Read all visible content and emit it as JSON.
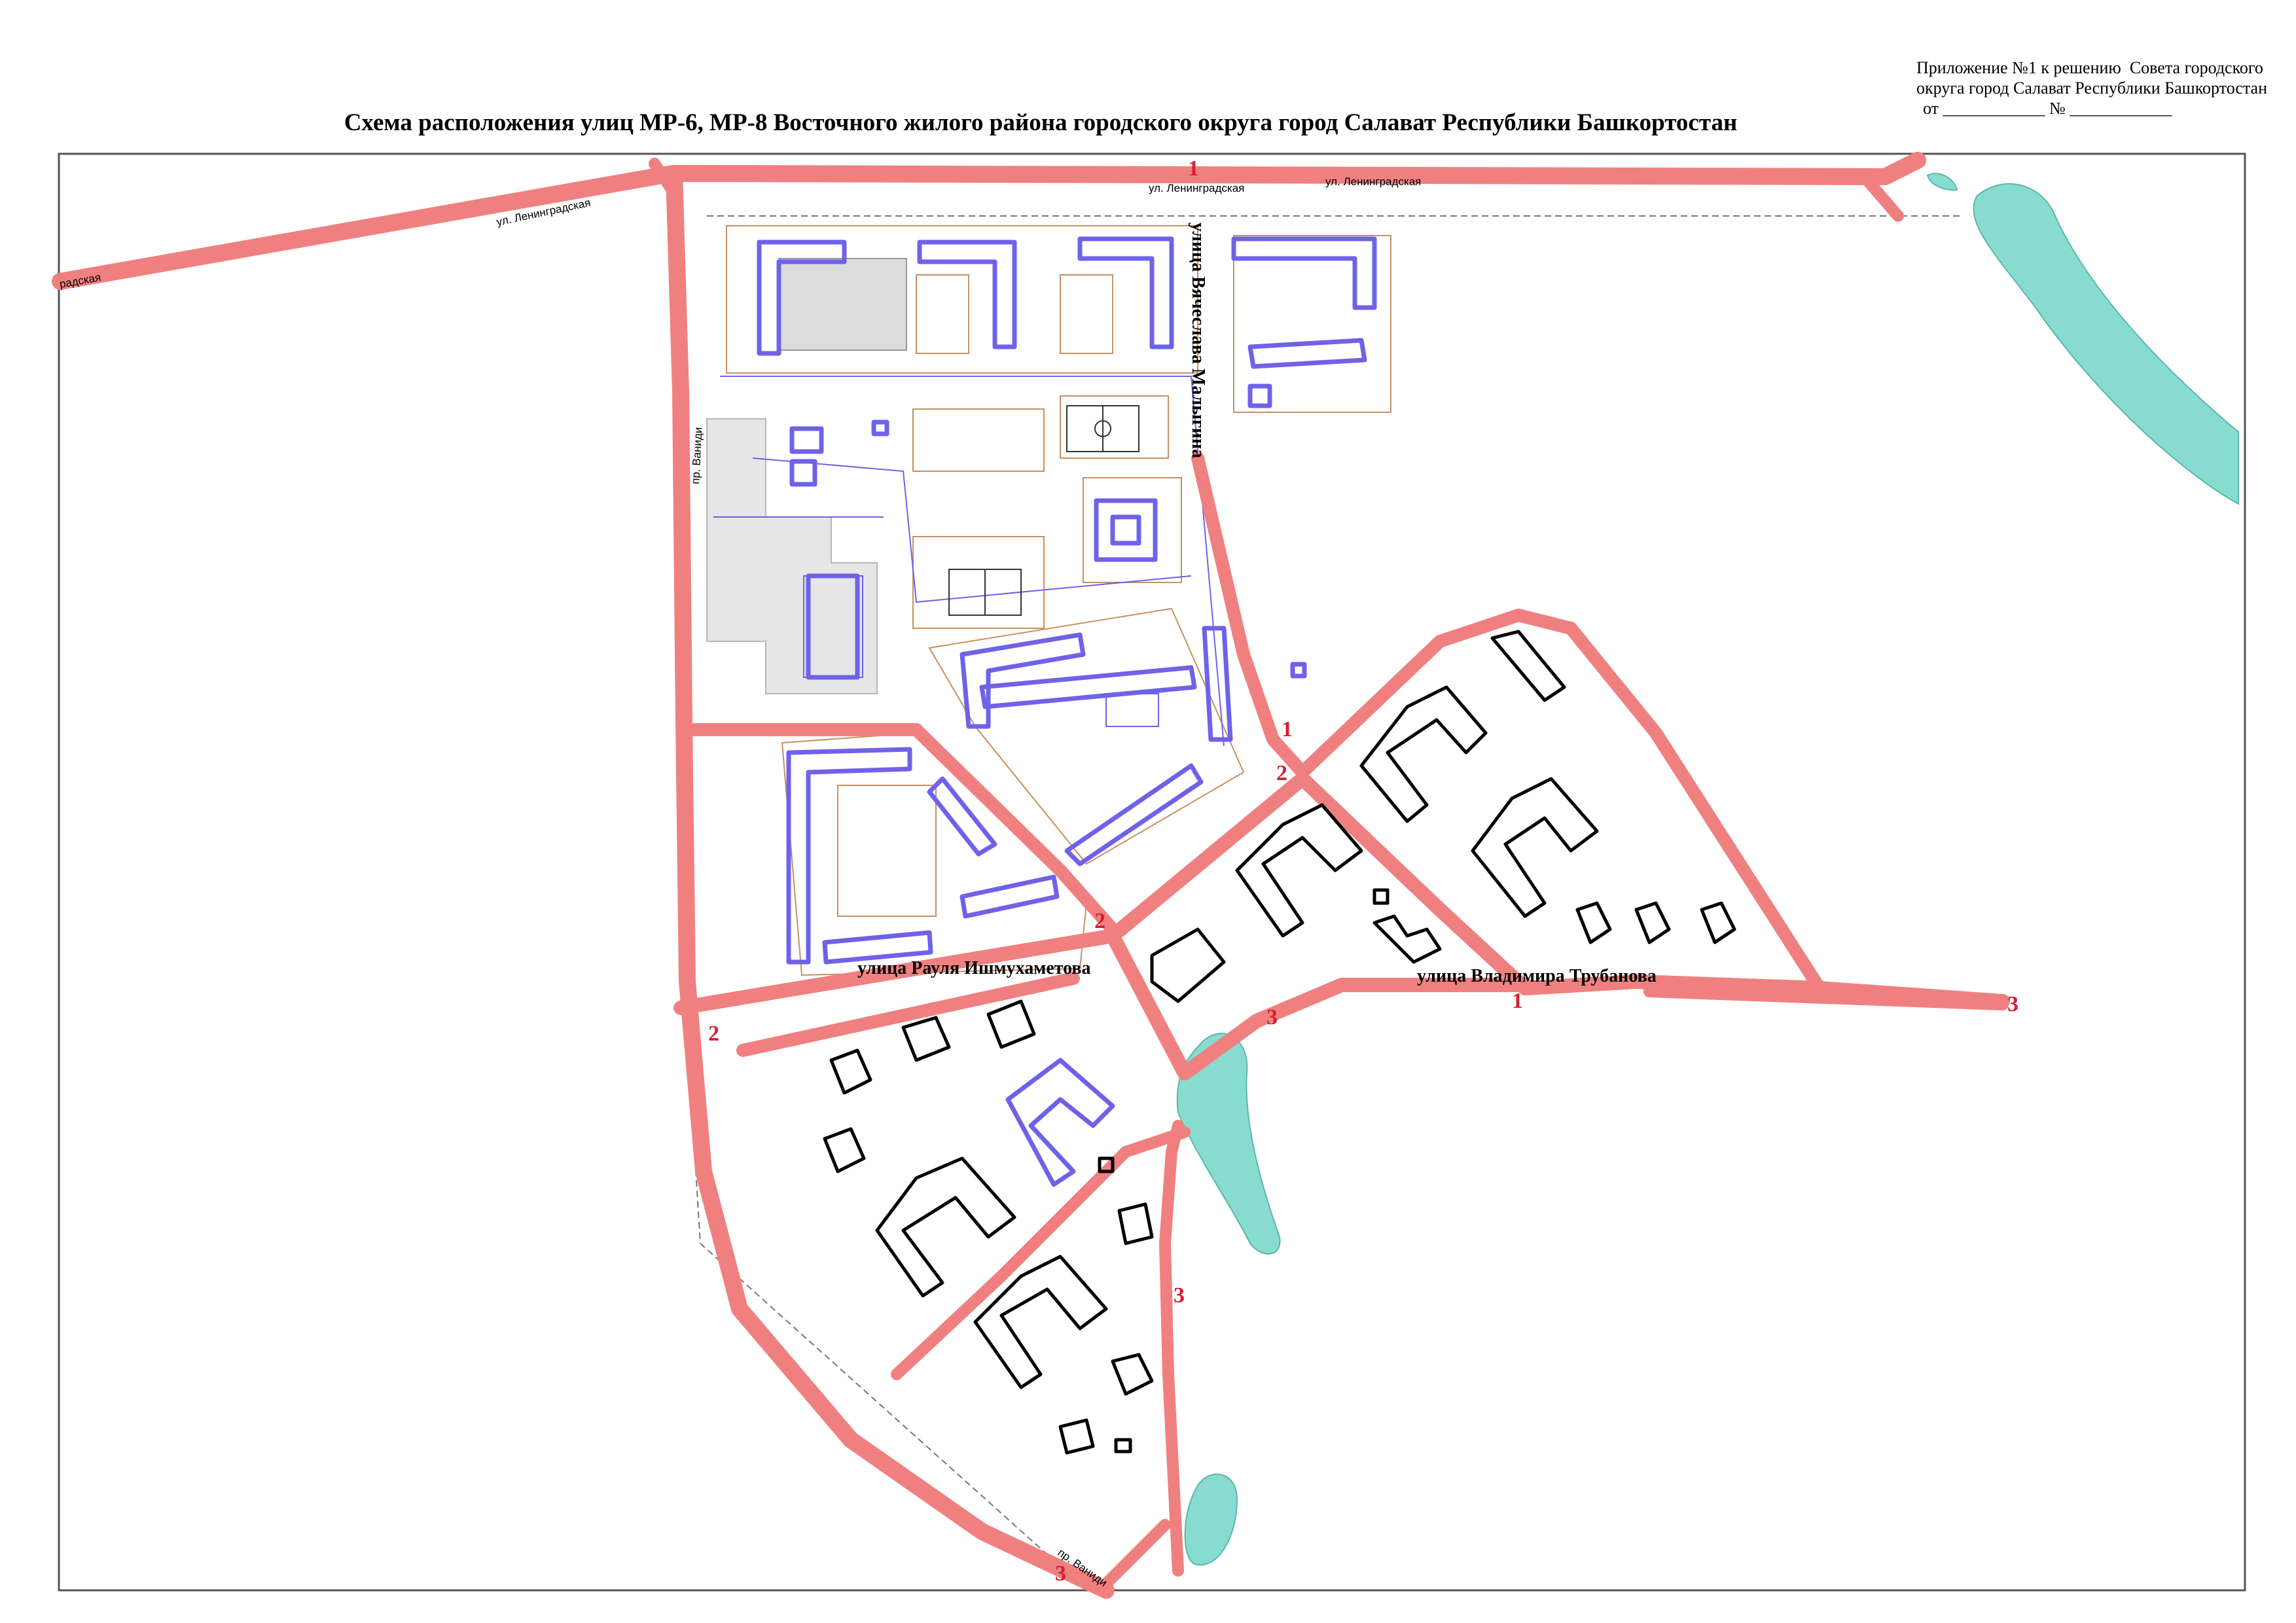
{
  "document": {
    "appendix_lines": [
      "Приложение №1 к решению  Совета городского",
      "округа город Салават Республики Башкортостан",
      "от ____________ № ____________"
    ],
    "title": "Схема расположения улиц МР-6, МР-8 Восточного жилого района городского округа город Салават Республики Башкортостан"
  },
  "map": {
    "street_labels": {
      "leningradskaya_left": "ул. Ленинградская",
      "leningradskaya_edge": "радская",
      "leningradskaya_mid": "ул. Ленинградская",
      "leningradskaya_right": "ул. Ленинградская",
      "malygina": "улица Вячеслава Малыгина",
      "vanidi_top": "пр. Ваниди",
      "vanidi_bottom": "пр. Ваниди",
      "ishmukhametova": "улица Рауля Ишмухаметова",
      "trubanova": "улица Владимира Трубанова"
    },
    "route_numbers": {
      "top": "1",
      "malygina_end": "1",
      "junction": "2",
      "ishmukhametova_mid": "2",
      "vanidi_mid": "2",
      "trubanova": "1",
      "east_end": "3",
      "south_curve": "3",
      "south_road": "3",
      "bottom": "3"
    },
    "colors": {
      "road": "#f08080",
      "route_number": "#d41f2f",
      "planned_building": "#6f62e8",
      "proposed_building": "#000000",
      "water": "#88dccf"
    }
  }
}
